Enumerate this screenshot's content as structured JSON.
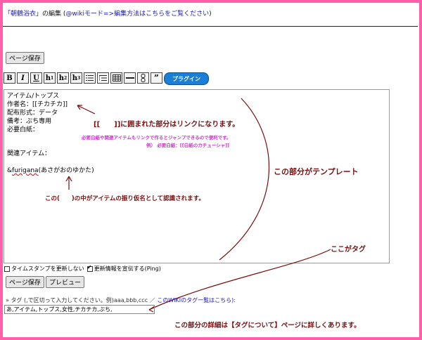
{
  "header": {
    "title_quoted": "「朝鶴浴衣」",
    "title_suffix": "の編集",
    "paren_open": " (",
    "wiki_mode_link": "@wikiモード",
    "arrow": "=>",
    "help_link": "編集方法はこちらをご覧ください",
    "paren_close": ")"
  },
  "toolbar": {
    "save_label": "ページ保存",
    "plugin_label": "プラグイン",
    "buttons": [
      "B",
      "I",
      "U",
      "h1",
      "h2",
      "h3",
      "list",
      "olist",
      "table",
      "hr",
      "link",
      "quote"
    ]
  },
  "editor": {
    "lines": [
      "アイテム/トップス",
      "作者名：[[チカチカ]]",
      "配布形式：データ",
      "備考：ぷち専用",
      "必要白紙：",
      "",
      "関連アイテム：",
      "",
      "&furigana(あさがおのゆかた)"
    ],
    "furigana_prefix": "&",
    "furigana_word": "furigana",
    "furigana_rest": "(あさがおのゆかた)"
  },
  "annotations": {
    "link_note": "[[　　]]に囲まれた部分はリンクになります。",
    "sub_note_1": "必要白紙や関連アイテムもリンクで作るとジャンプできるので便利です。",
    "sub_note_2": "例） 必要白紙：[[白紙のカチューシャ]]",
    "furigana_note": "この(　　)の中がアイテムの振り仮名として認識されます。",
    "template_note": "この部分がテンプレート",
    "tag_pointer": "ここがタグ",
    "tag_detail": "この部分の詳細は【タグについて】ページに詳しくあります。"
  },
  "options": {
    "timestamp_label": "タイムスタンプを更新しない",
    "timestamp_checked": false,
    "ping_label": "更新情報を宣伝する(Ping)",
    "ping_checked": true
  },
  "actions": {
    "save_label": "ページ保存",
    "preview_label": "プレビュー"
  },
  "tags": {
    "label_prefix": "» タグ (,で区切って入力してください。例)aaa,bbb,ccc ／ ",
    "list_link": "このWIKIのタグ一覧はこちら",
    "label_suffix": "):",
    "value": "あ,アイテム,トップス,女性,チカチカ,ぷち,"
  },
  "colors": {
    "frame": "#ff5fa8",
    "annotation_dark": "#7a0d0d",
    "annotation_pink": "#cc33cc",
    "link": "#1a1aa6",
    "plugin_button": "#1a7fd6"
  }
}
